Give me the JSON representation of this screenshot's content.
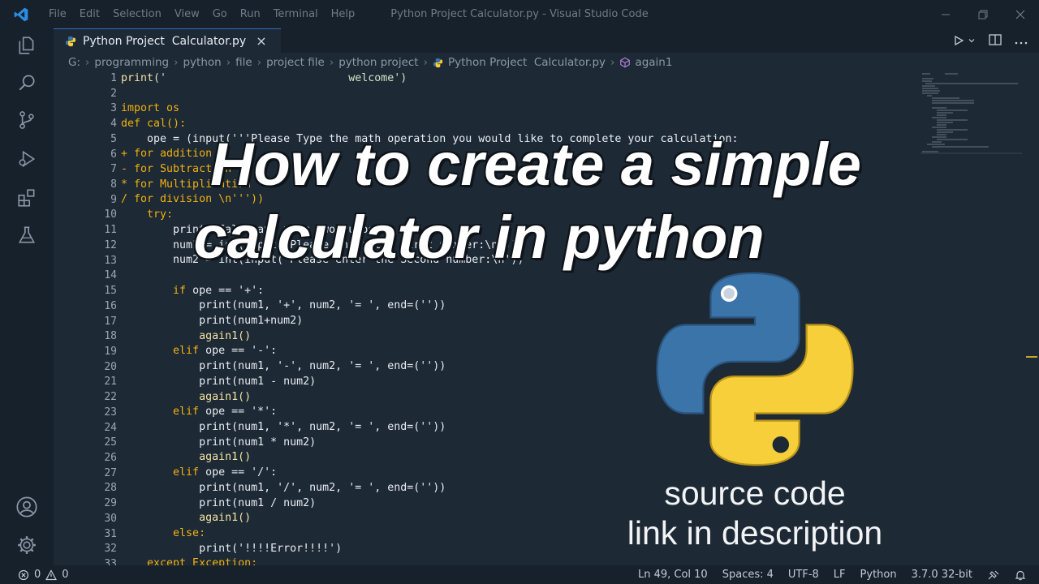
{
  "window": {
    "title": "Python Project Calculator.py - Visual Studio Code",
    "menu": [
      "File",
      "Edit",
      "Selection",
      "View",
      "Go",
      "Run",
      "Terminal",
      "Help"
    ]
  },
  "tab": {
    "label": "Python Project  Calculator.py",
    "close": "×"
  },
  "breadcrumb": [
    "G:",
    "programming",
    "python",
    "file",
    "project file",
    "python project",
    "Python Project  Calculator.py",
    "again1"
  ],
  "code": {
    "line_numbers": [
      "1",
      "2",
      "3",
      "4",
      "5",
      "6",
      "7",
      "8",
      "9",
      "10",
      "11",
      "12",
      "13",
      "14",
      "15",
      "16",
      "17",
      "18",
      "19",
      "20",
      "21",
      "22",
      "23",
      "24",
      "25",
      "26",
      "27",
      "28",
      "29",
      "30",
      "31",
      "32",
      "33"
    ],
    "lines": {
      "l1_fn": "print",
      "l1_str": "('                            welcome')",
      "l3_kw": "import",
      "l3_rest": " os",
      "l4_kw": "def",
      "l4_rest": " cal():",
      "l5": "    ope = (input('''Please Type the math operation you would like to complete your calculation:",
      "l6": "+ for addition",
      "l7": "- for Subtraction",
      "l8": "* for Multiplication",
      "l9": "/ for division \\n'''))",
      "l10_kw": "    try:",
      "l11": "        print('Calculate your two number')",
      "l12": "        num1 = int(input('Please enter the first number:\\n'))",
      "l13": "        num2 = int(input('Please enter the Second number:\\n'))",
      "l15_kw": "        if",
      "l15_rest": " ope == '+':",
      "l16": "            print(num1, '+', num2, '= ', end=(''))",
      "l17": "            print(num1+num2)",
      "l18": "            again1()",
      "l19_kw": "        elif",
      "l19_rest": " ope == '-':",
      "l20": "            print(num1, '-', num2, '= ', end=(''))",
      "l21": "            print(num1 - num2)",
      "l22": "            again1()",
      "l23_kw": "        elif",
      "l23_rest": " ope == '*':",
      "l24": "            print(num1, '*', num2, '= ', end=(''))",
      "l25": "            print(num1 * num2)",
      "l26": "            again1()",
      "l27_kw": "        elif",
      "l27_rest": " ope == '/':",
      "l28": "            print(num1, '/', num2, '= ', end=(''))",
      "l29": "            print(num1 / num2)",
      "l30": "            again1()",
      "l31_kw": "        else:",
      "l32": "            print('!!!!Error!!!!')",
      "l33": "    except Exception:"
    }
  },
  "overlay": {
    "title_line1": "How to create a simple",
    "title_line2": "calculator in python",
    "source_line1": "source code",
    "source_line2": "link in description"
  },
  "statusbar": {
    "errors": "0",
    "warnings": "0",
    "position": "Ln 49, Col 10",
    "spaces": "Spaces: 4",
    "encoding": "UTF-8",
    "eol": "LF",
    "language": "Python",
    "interpreter": "3.7.0 32-bit"
  },
  "colors": {
    "editor_bg": "#1d2935",
    "chrome_bg": "#17212b",
    "keyword": "#f2b10f",
    "accent": "#2d6cc4",
    "python_blue": "#3b74a8",
    "python_yellow": "#f7cf3b"
  },
  "icons": [
    "vscode-logo-icon",
    "explorer-icon",
    "search-icon",
    "source-control-icon",
    "run-debug-icon",
    "extensions-icon",
    "testing-icon",
    "account-icon",
    "settings-gear-icon",
    "python-file-icon",
    "run-icon",
    "split-editor-icon",
    "more-actions-icon",
    "symbol-method-icon",
    "error-icon",
    "warning-icon",
    "feedback-icon",
    "bell-icon",
    "python-logo-icon"
  ]
}
